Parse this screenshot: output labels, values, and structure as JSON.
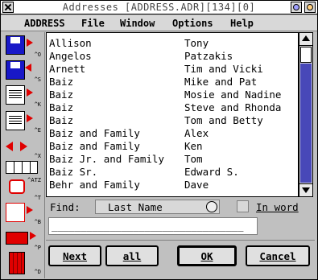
{
  "window": {
    "title": "Addresses [ADDRESS.ADR][134][0]"
  },
  "menu": {
    "items": [
      "ADDRESS",
      "File",
      "Window",
      "Options",
      "Help"
    ]
  },
  "toolbar": {
    "tools": [
      {
        "icon": "save-disk-icon",
        "hint": "^O"
      },
      {
        "icon": "save-as-disk-icon",
        "hint": "^S"
      },
      {
        "icon": "edit-card-icon",
        "hint": "^K"
      },
      {
        "icon": "edit-list-icon",
        "hint": "^E"
      },
      {
        "icon": "swap-arrows-icon",
        "hint": "^X"
      },
      {
        "icon": "columns-icon",
        "hint": "^ATZ"
      },
      {
        "icon": "phone-icon",
        "hint": "^T"
      },
      {
        "icon": "print-labels-icon",
        "hint": "^B"
      },
      {
        "icon": "printer-icon",
        "hint": "^P"
      },
      {
        "icon": "trash-icon",
        "hint": "^D"
      }
    ]
  },
  "list": {
    "rows": [
      {
        "last": "Allison",
        "first": "Tony"
      },
      {
        "last": "Angelos",
        "first": "Patzakis"
      },
      {
        "last": "Arnett",
        "first": "Tim and Vicki"
      },
      {
        "last": "Baiz",
        "first": "Mike and Pat"
      },
      {
        "last": "Baiz",
        "first": "Mosie and Nadine"
      },
      {
        "last": "Baiz",
        "first": "Steve and Rhonda"
      },
      {
        "last": "Baiz",
        "first": "Tom and Betty"
      },
      {
        "last": "Baiz and Family",
        "first": "Alex"
      },
      {
        "last": "Baiz and Family",
        "first": "Ken"
      },
      {
        "last": "Baiz Jr. and Family",
        "first": "Tom"
      },
      {
        "last": "Baiz Sr.",
        "first": "Edward S."
      },
      {
        "last": "Behr and Family",
        "first": "Dave"
      }
    ]
  },
  "find": {
    "label": "Find:",
    "field": "Last Name",
    "in_word_label": "In word",
    "in_word_checked": false,
    "input_value": "",
    "input_placeholder": "_________________________________"
  },
  "buttons": {
    "next": "Next",
    "all": "all",
    "ok": "OK",
    "cancel": "Cancel"
  },
  "colors": {
    "scroll_track": "#4848b8",
    "disk": "#1818c8",
    "arrow": "#e00000"
  }
}
